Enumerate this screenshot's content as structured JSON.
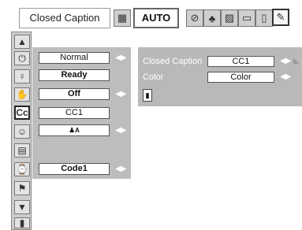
{
  "header": {
    "title": "Closed Caption",
    "mode_value": "AUTO",
    "icons": [
      "picture-icon",
      "color-adjust-icon",
      "setting-icon",
      "screen-icon",
      "image-icon",
      "door-icon",
      "pen-icon"
    ]
  },
  "sidebar": {
    "items": [
      "up-arrow-icon",
      "power-icon",
      "bulb-icon",
      "hand-icon",
      "closed-caption-icon",
      "face-icon",
      "display-icon",
      "clock-icon",
      "flag-icon",
      "down-arrow-icon",
      "exit-icon"
    ]
  },
  "middle": {
    "rows": [
      "Normal",
      "Ready",
      "Off",
      "CC1",
      "A",
      "",
      "Code1"
    ]
  },
  "right": {
    "closed_caption_label": "Closed Caption",
    "closed_caption_value": "CC1",
    "color_label": "Color",
    "color_value": "Color"
  },
  "colors": {
    "panel_gray": "#bdbdbd",
    "sidebar_gray": "#cdcdcd",
    "text_white": "#ffffff"
  }
}
